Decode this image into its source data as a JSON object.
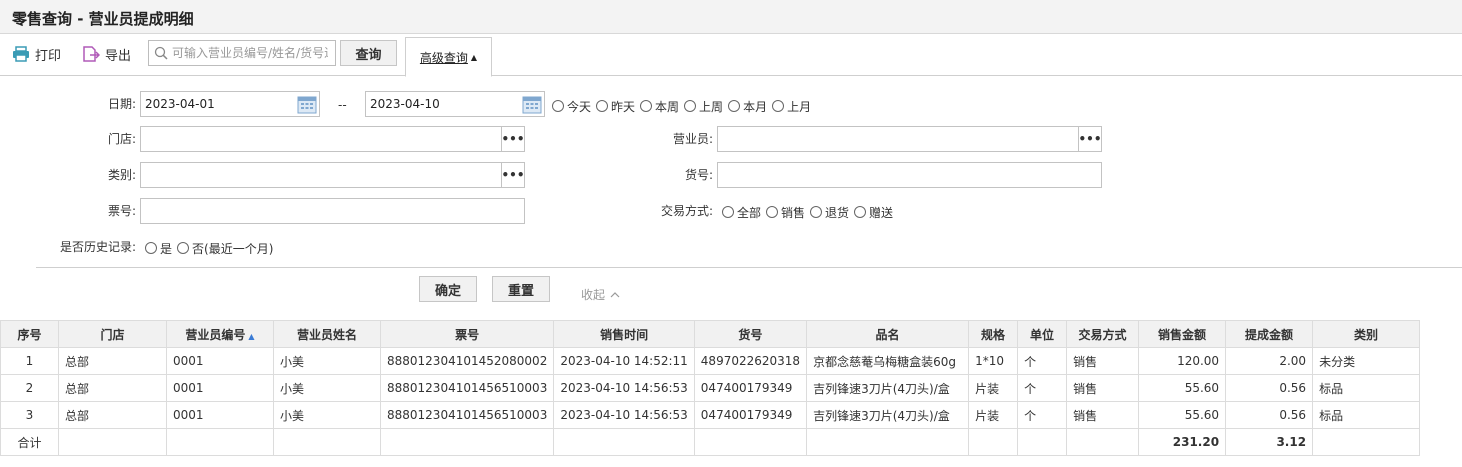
{
  "window": {
    "title": "零售查询 - 营业员提成明细"
  },
  "toolbar": {
    "print_label": "打印",
    "export_label": "导出",
    "search_placeholder": "可输入营业员编号/姓名/货号进行查询",
    "query_label": "查询",
    "advanced_label": "高级查询"
  },
  "form": {
    "date_label": "日期:",
    "date_from": "2023-04-01",
    "date_sep": "--",
    "date_to": "2023-04-10",
    "date_presets": [
      "今天",
      "昨天",
      "本周",
      "上周",
      "本月",
      "上月"
    ],
    "store_label": "门店:",
    "clerk_label": "营业员:",
    "category_label": "类别:",
    "sku_label": "货号:",
    "ticket_label": "票号:",
    "trade_label": "交易方式:",
    "trade_options": [
      "全部",
      "销售",
      "退货",
      "赠送"
    ],
    "history_label": "是否历史记录:",
    "history_options": [
      "是",
      "否(最近一个月)"
    ],
    "confirm_label": "确定",
    "reset_label": "重置",
    "collapse_label": "收起"
  },
  "table": {
    "columns": [
      "序号",
      "门店",
      "营业员编号",
      "营业员姓名",
      "票号",
      "销售时间",
      "货号",
      "品名",
      "规格",
      "单位",
      "交易方式",
      "销售金额",
      "提成金额",
      "类别"
    ],
    "rows": [
      [
        "1",
        "总部",
        "0001",
        "小美",
        "888012304101452080002",
        "2023-04-10 14:52:11",
        "4897022620318",
        "京都念慈菴乌梅糖盒装60g",
        "1*10",
        "个",
        "销售",
        "120.00",
        "2.00",
        "未分类"
      ],
      [
        "2",
        "总部",
        "0001",
        "小美",
        "888012304101456510003",
        "2023-04-10 14:56:53",
        "047400179349",
        "吉列锋速3刀片(4刀头)/盒",
        "片装",
        "个",
        "销售",
        "55.60",
        "0.56",
        "标品"
      ],
      [
        "3",
        "总部",
        "0001",
        "小美",
        "888012304101456510003",
        "2023-04-10 14:56:53",
        "047400179349",
        "吉列锋速3刀片(4刀头)/盒",
        "片装",
        "个",
        "销售",
        "55.60",
        "0.56",
        "标品"
      ]
    ],
    "total_label": "合计",
    "total_sales": "231.20",
    "total_commission": "3.12"
  },
  "colors": {
    "print_icon": "#3a9bb5",
    "export_icon": "#b05ab8",
    "calendar_icon": "#7fa7cf",
    "sort_indicator": "#3a7bd5"
  },
  "icons": {
    "print": "printer-icon",
    "export": "export-icon",
    "search": "search-icon",
    "calendar": "calendar-icon",
    "more": "more-dots-icon"
  }
}
